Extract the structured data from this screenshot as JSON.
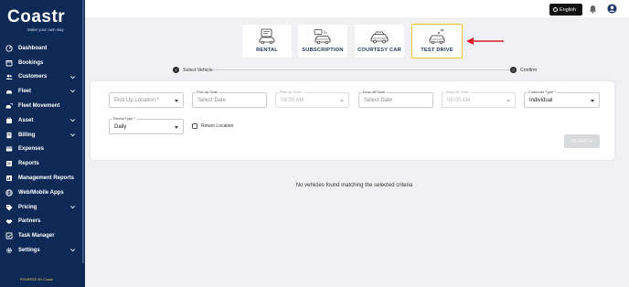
{
  "brand": {
    "name": "Coastr",
    "tagline": "Make your own way",
    "powered_by": "POWERED BY Coastr"
  },
  "sidebar": {
    "items": [
      {
        "label": "Dashboard",
        "icon": "dashboard-icon",
        "expandable": false
      },
      {
        "label": "Bookings",
        "icon": "bookings-icon",
        "expandable": false
      },
      {
        "label": "Customers",
        "icon": "customers-icon",
        "expandable": true
      },
      {
        "label": "Fleet",
        "icon": "car-icon",
        "expandable": true
      },
      {
        "label": "Fleet Movement",
        "icon": "fleet-movement-icon",
        "expandable": false
      },
      {
        "label": "Asset",
        "icon": "asset-icon",
        "expandable": true
      },
      {
        "label": "Billing",
        "icon": "billing-icon",
        "expandable": true
      },
      {
        "label": "Expenses",
        "icon": "expenses-icon",
        "expandable": false
      },
      {
        "label": "Reports",
        "icon": "reports-icon",
        "expandable": false
      },
      {
        "label": "Management Reports",
        "icon": "management-reports-icon",
        "expandable": false
      },
      {
        "label": "Web/Mobile Apps",
        "icon": "apps-icon",
        "expandable": false
      },
      {
        "label": "Pricing",
        "icon": "pricing-icon",
        "expandable": true
      },
      {
        "label": "Partners",
        "icon": "partners-icon",
        "expandable": false
      },
      {
        "label": "Task Manager",
        "icon": "task-manager-icon",
        "expandable": false
      },
      {
        "label": "Settings",
        "icon": "gear-icon",
        "expandable": true
      }
    ]
  },
  "header": {
    "language": "English"
  },
  "booking_types": [
    {
      "label": "RENTAL",
      "icon": "rental-car-icon",
      "selected": false
    },
    {
      "label": "SUBSCRIPTION",
      "icon": "subscription-car-icon",
      "selected": false
    },
    {
      "label": "COURTESY CAR",
      "icon": "courtesy-car-icon",
      "selected": false
    },
    {
      "label": "TEST DRIVE",
      "icon": "test-drive-car-icon",
      "selected": true
    }
  ],
  "stepper": {
    "steps": [
      {
        "number": "1",
        "label": "Select Vehicle"
      },
      {
        "number": "2",
        "label": "Confirm"
      }
    ]
  },
  "form": {
    "pickup_location": {
      "placeholder": "Pick Up Location *"
    },
    "pickup_date": {
      "label": "Pick-up Date",
      "placeholder": "Select Date"
    },
    "pickup_time": {
      "label": "Pick-up Time *",
      "value": "08:00 AM"
    },
    "dropoff_date": {
      "label": "Drop-off Date",
      "placeholder": "Select Date"
    },
    "dropoff_time": {
      "label": "Drop-off Time *",
      "value": "08:00 AM"
    },
    "customer_type": {
      "label": "Customer Type *",
      "value": "Individual"
    },
    "rental_type": {
      "label": "Rental Type *",
      "value": "Daily"
    },
    "return_location": {
      "label": "Return Location",
      "checked": false
    },
    "search_label": "SEARCH"
  },
  "results": {
    "empty_message": "No vehicles found matching the selected criteria"
  },
  "colors": {
    "sidebar_bg": "#0d2a57",
    "selected_border": "#f0c330",
    "annotation_arrow": "#d61f26"
  }
}
